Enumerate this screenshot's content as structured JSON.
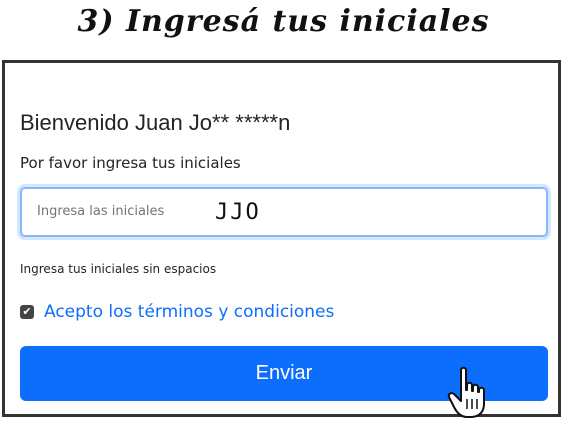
{
  "step": {
    "title": "3) Ingresá tus iniciales"
  },
  "form": {
    "welcome": "Bienvenido Juan Jo** *****n",
    "subtitle": "Por favor ingresa tus iniciales",
    "input_placeholder": "Ingresa las iniciales",
    "input_value": "JJO",
    "help_text": "Ingresa tus iniciales sin espacios",
    "terms_label": "Acepto los términos y condiciones",
    "terms_checked": true,
    "submit_label": "Enviar"
  },
  "colors": {
    "primary": "#0d6efd",
    "focus_border": "#86b7fe",
    "frame_border": "#333333"
  },
  "icons": {
    "checkbox": "checkmark-icon",
    "cursor": "hand-pointer-cursor-icon"
  }
}
